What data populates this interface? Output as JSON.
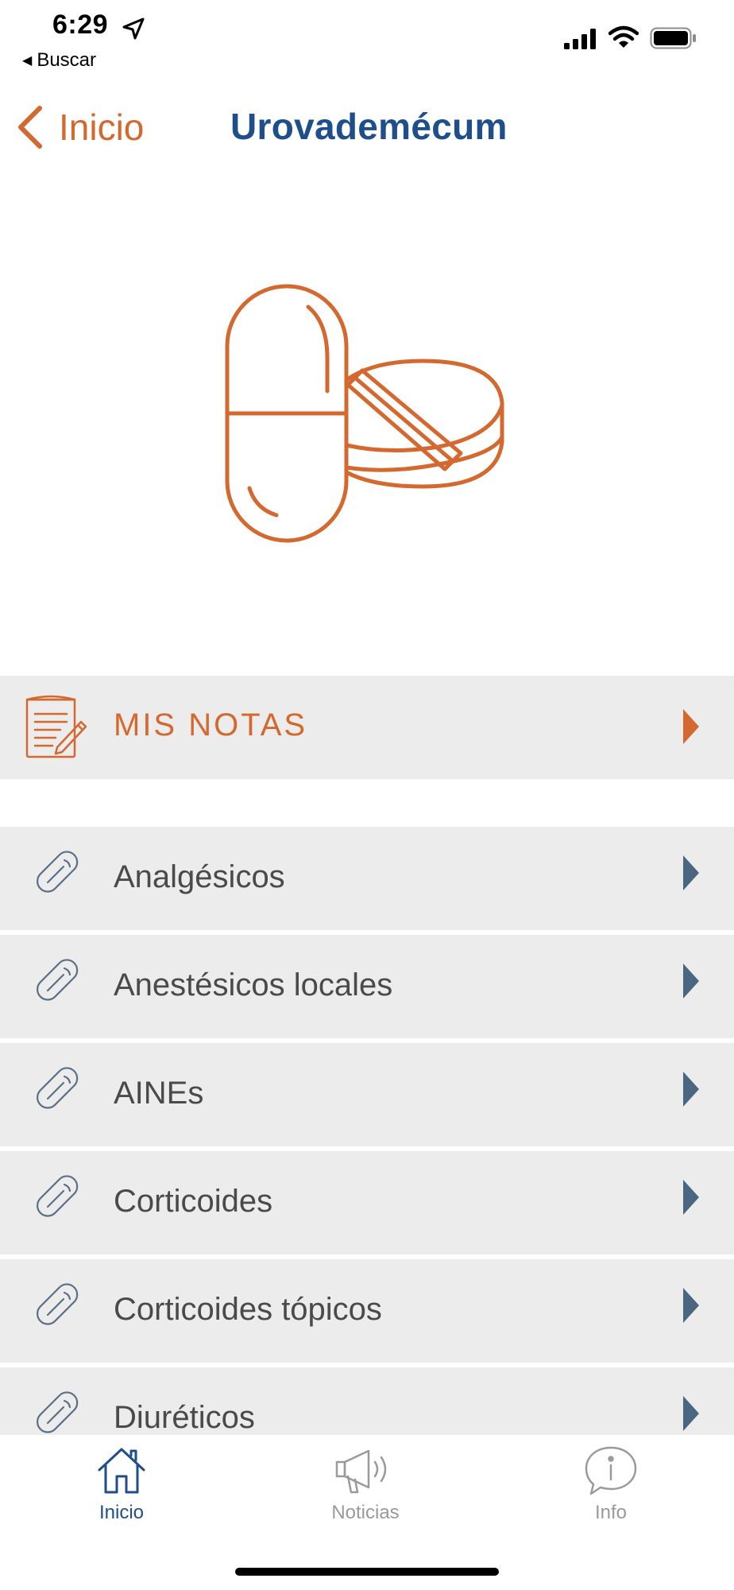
{
  "status_bar": {
    "time": "6:29",
    "back_app_label": "Buscar"
  },
  "nav": {
    "back_label": "Inicio",
    "title": "Urovademécum"
  },
  "notes": {
    "label": "MIS NOTAS"
  },
  "categories": [
    {
      "label": "Analgésicos"
    },
    {
      "label": "Anestésicos locales"
    },
    {
      "label": "AINEs"
    },
    {
      "label": "Corticoides"
    },
    {
      "label": "Corticoides tópicos"
    },
    {
      "label": "Diuréticos"
    }
  ],
  "tabs": [
    {
      "label": "Inicio",
      "icon": "home-icon",
      "active": true
    },
    {
      "label": "Noticias",
      "icon": "megaphone-icon",
      "active": false
    },
    {
      "label": "Info",
      "icon": "info-bubble-icon",
      "active": false
    }
  ],
  "colors": {
    "accent_orange": "#d4682f",
    "title_blue": "#1f4e8c",
    "row_background": "#ececec",
    "chevron_slate": "#4a6680"
  }
}
